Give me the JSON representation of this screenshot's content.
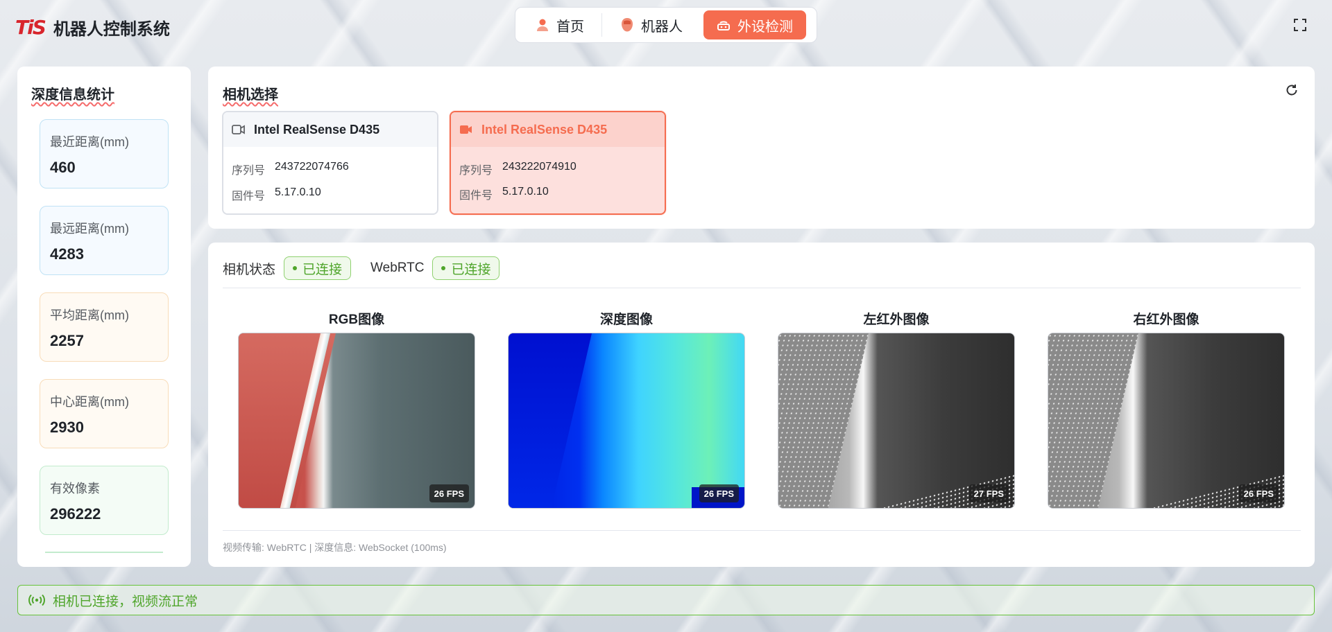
{
  "app": {
    "logo_text": "TiS",
    "title": "机器人控制系统"
  },
  "nav": {
    "items": [
      {
        "label": "首页",
        "icon": "user-icon",
        "active": false
      },
      {
        "label": "机器人",
        "icon": "robot-head-icon",
        "active": false
      },
      {
        "label": "外设检测",
        "icon": "device-icon",
        "active": true
      }
    ]
  },
  "depth_stats": {
    "title": "深度信息统计",
    "items": [
      {
        "label": "最近距离(mm)",
        "value": "460"
      },
      {
        "label": "最远距离(mm)",
        "value": "4283"
      },
      {
        "label": "平均距离(mm)",
        "value": "2257"
      },
      {
        "label": "中心距离(mm)",
        "value": "2930"
      },
      {
        "label": "有效像素",
        "value": "296222"
      }
    ]
  },
  "camera_select": {
    "title": "相机选择",
    "cameras": [
      {
        "name": "Intel RealSense D435",
        "serial_label": "序列号",
        "serial": "243722074766",
        "firmware_label": "固件号",
        "firmware": "5.17.0.10",
        "selected": false
      },
      {
        "name": "Intel RealSense D435",
        "serial_label": "序列号",
        "serial": "243222074910",
        "firmware_label": "固件号",
        "firmware": "5.17.0.10",
        "selected": true
      }
    ]
  },
  "video": {
    "camera_status_label": "相机状态",
    "camera_status": "已连接",
    "webrtc_label": "WebRTC",
    "webrtc_status": "已连接",
    "feeds": [
      {
        "title": "RGB图像",
        "fps": "26 FPS"
      },
      {
        "title": "深度图像",
        "fps": "26 FPS"
      },
      {
        "title": "左红外图像",
        "fps": "27 FPS"
      },
      {
        "title": "右红外图像",
        "fps": "26 FPS"
      }
    ],
    "footer": "视频传输: WebRTC | 深度信息: WebSocket (100ms)"
  },
  "status_bar": {
    "text": "相机已连接，视频流正常"
  },
  "colors": {
    "accent": "#f56c4f",
    "success": "#4fa52b",
    "brand_red": "#d8252c"
  }
}
